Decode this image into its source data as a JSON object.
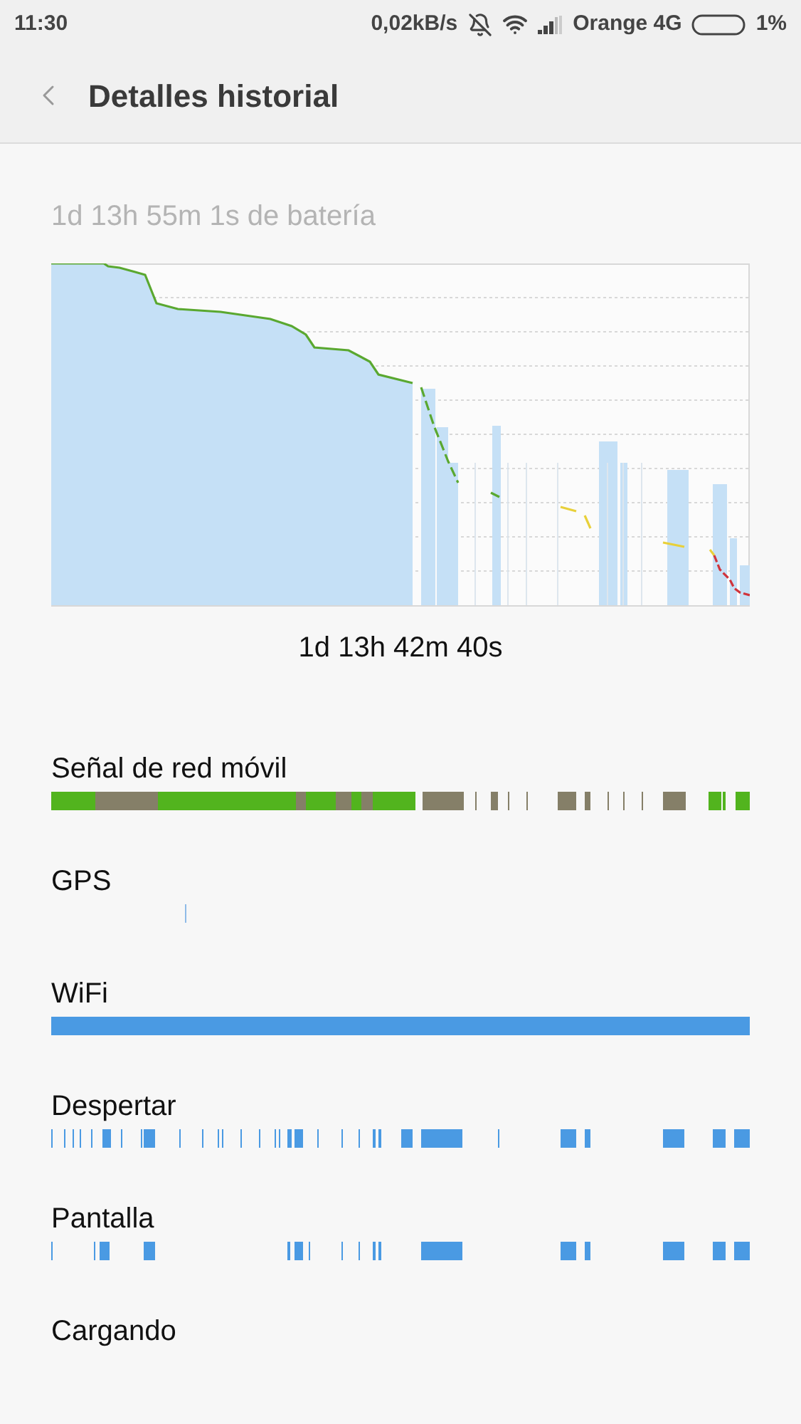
{
  "status_bar": {
    "time": "11:30",
    "speed": "0,02kB/s",
    "carrier": "Orange 4G",
    "battery": "1%"
  },
  "header": {
    "title": "Detalles historial"
  },
  "summary": "1d 13h 55m 1s de batería",
  "duration": "1d 13h 42m 40s",
  "rows": [
    {
      "label": "Señal de red móvil",
      "kind": "signal"
    },
    {
      "label": "GPS",
      "kind": "gps"
    },
    {
      "label": "WiFi",
      "kind": "wifi"
    },
    {
      "label": "Despertar",
      "kind": "wake"
    },
    {
      "label": "Pantalla",
      "kind": "screen"
    },
    {
      "label": "Cargando",
      "kind": "charging"
    }
  ]
}
